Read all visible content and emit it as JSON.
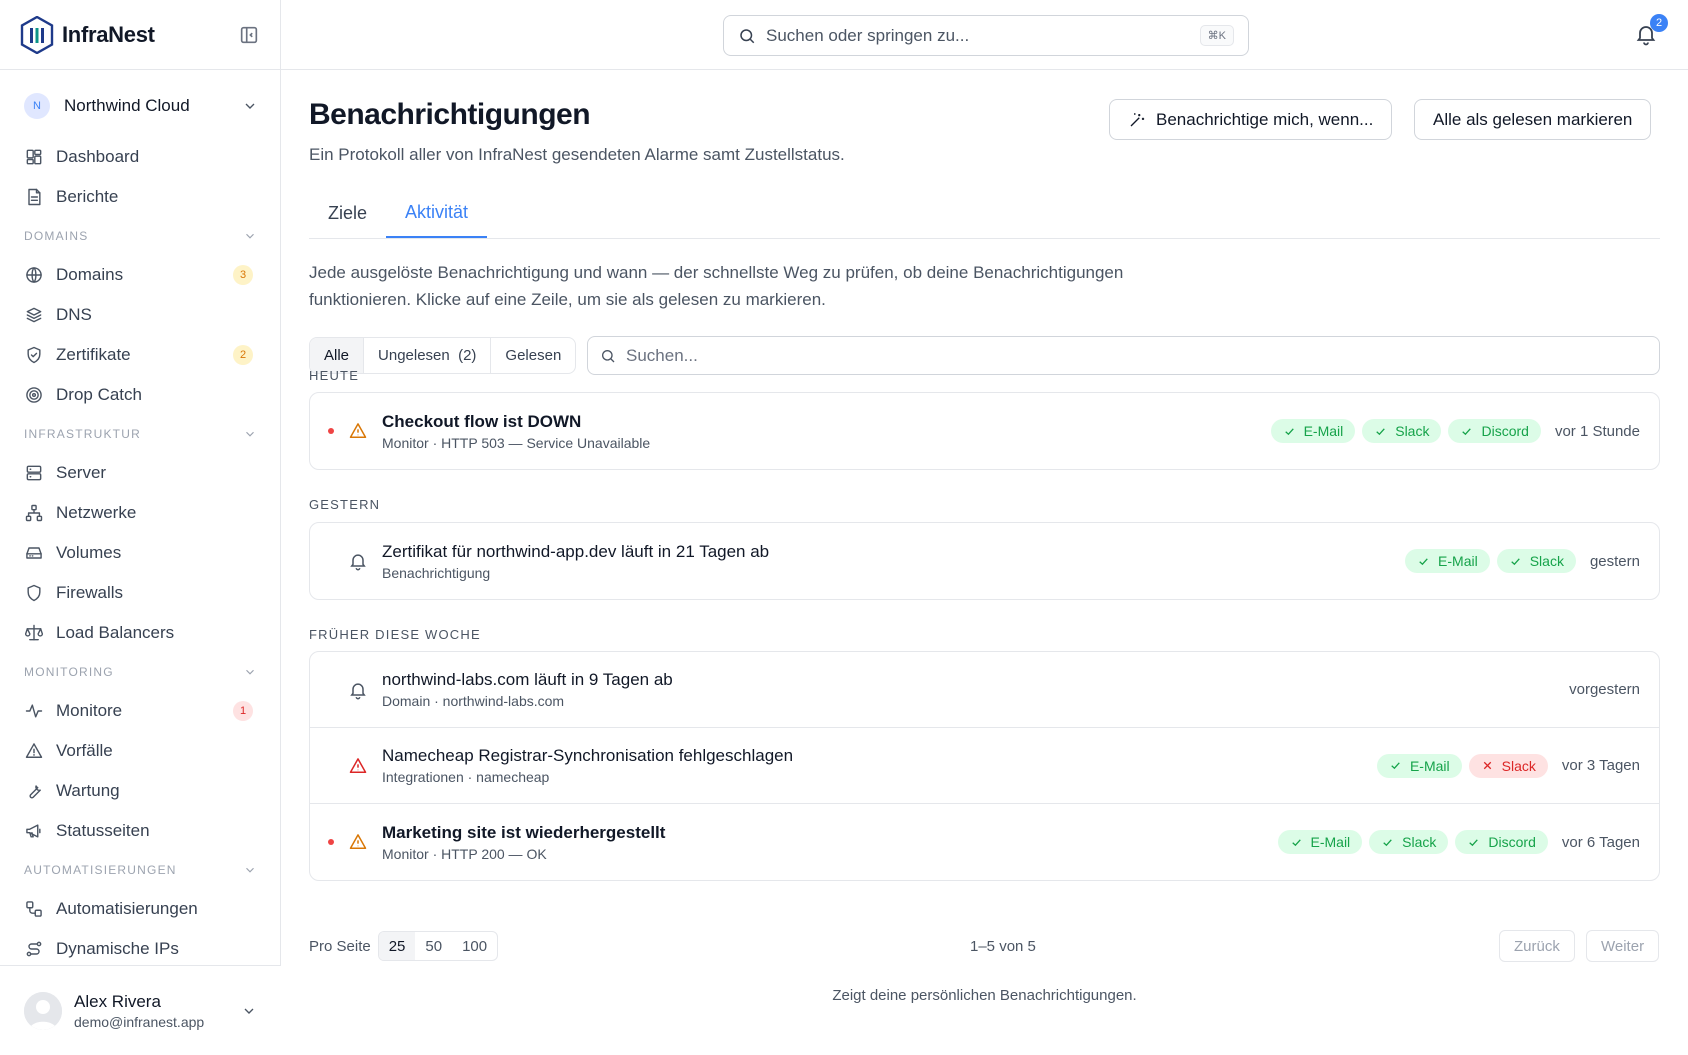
{
  "app": {
    "name": "InfraNest"
  },
  "workspace": {
    "initial": "N",
    "name": "Northwind Cloud"
  },
  "nav": {
    "top": [
      {
        "label": "Dashboard",
        "icon": "dashboard-icon"
      },
      {
        "label": "Berichte",
        "icon": "report-icon"
      }
    ],
    "sections": [
      {
        "title": "DOMAINS",
        "items": [
          {
            "label": "Domains",
            "icon": "globe-icon",
            "badge": "3",
            "badge_color": "amber"
          },
          {
            "label": "DNS",
            "icon": "layers-icon"
          },
          {
            "label": "Zertifikate",
            "icon": "shield-check-icon",
            "badge": "2",
            "badge_color": "amber"
          },
          {
            "label": "Drop Catch",
            "icon": "target-icon"
          }
        ]
      },
      {
        "title": "INFRASTRUKTUR",
        "items": [
          {
            "label": "Server",
            "icon": "server-icon"
          },
          {
            "label": "Netzwerke",
            "icon": "network-icon"
          },
          {
            "label": "Volumes",
            "icon": "hard-drive-icon"
          },
          {
            "label": "Firewalls",
            "icon": "shield-icon"
          },
          {
            "label": "Load Balancers",
            "icon": "scale-icon"
          }
        ]
      },
      {
        "title": "MONITORING",
        "items": [
          {
            "label": "Monitore",
            "icon": "activity-icon",
            "badge": "1",
            "badge_color": "red"
          },
          {
            "label": "Vorfälle",
            "icon": "alert-triangle-icon"
          },
          {
            "label": "Wartung",
            "icon": "wrench-icon"
          },
          {
            "label": "Statusseiten",
            "icon": "megaphone-icon"
          }
        ]
      },
      {
        "title": "AUTOMATISIERUNGEN",
        "items": [
          {
            "label": "Automatisierungen",
            "icon": "workflow-icon"
          },
          {
            "label": "Dynamische IPs",
            "icon": "route-icon"
          }
        ]
      }
    ]
  },
  "user": {
    "name": "Alex Rivera",
    "email": "demo@infranest.app"
  },
  "topbar": {
    "search_placeholder": "Suchen oder springen zu...",
    "shortcut": "⌘K",
    "notif_count": "2"
  },
  "page": {
    "title": "Benachrichtigungen",
    "subtitle": "Ein Protokoll aller von InfraNest gesendeten Alarme samt Zustellstatus.",
    "btn_notify": "Benachrichtige mich, wenn...",
    "btn_mark_all": "Alle als gelesen markieren",
    "tabs": [
      "Ziele",
      "Aktivität"
    ],
    "active_tab": 1,
    "intro": "Jede ausgelöste Benachrichtigung und wann — der schnellste Weg zu prüfen, ob deine Benachrichtigungen funktionieren. Klicke auf eine Zeile, um sie als gelesen zu markieren.",
    "filters": {
      "all": "Alle",
      "unread": "Ungelesen",
      "unread_count": "(2)",
      "read": "Gelesen"
    },
    "search_placeholder": "Suchen..."
  },
  "groups": [
    {
      "title": "HEUTE",
      "items": [
        {
          "unread": true,
          "icon": "warning-amber",
          "title": "Checkout flow ist DOWN",
          "meta": "Monitor · HTTP 503 — Service Unavailable",
          "channels": [
            {
              "name": "E-Mail",
              "status": "ok"
            },
            {
              "name": "Slack",
              "status": "ok"
            },
            {
              "name": "Discord",
              "status": "ok"
            }
          ],
          "time": "vor 1 Stunde"
        }
      ]
    },
    {
      "title": "GESTERN",
      "items": [
        {
          "unread": false,
          "icon": "bell",
          "title": "Zertifikat für northwind-app.dev läuft in 21 Tagen ab",
          "meta": "Benachrichtigung",
          "channels": [
            {
              "name": "E-Mail",
              "status": "ok"
            },
            {
              "name": "Slack",
              "status": "ok"
            }
          ],
          "time": "gestern"
        }
      ]
    },
    {
      "title": "FRÜHER DIESE WOCHE",
      "items": [
        {
          "unread": false,
          "icon": "bell",
          "title": "northwind-labs.com läuft in 9 Tagen ab",
          "meta": "Domain · northwind-labs.com",
          "channels": [],
          "time": "vorgestern"
        },
        {
          "unread": false,
          "icon": "warning-red",
          "title": "Namecheap Registrar-Synchronisation fehlgeschlagen",
          "meta": "Integrationen · namecheap",
          "channels": [
            {
              "name": "E-Mail",
              "status": "ok"
            },
            {
              "name": "Slack",
              "status": "fail"
            }
          ],
          "time": "vor 3 Tagen"
        },
        {
          "unread": true,
          "icon": "warning-amber",
          "title": "Marketing site ist wiederhergestellt",
          "meta": "Monitor · HTTP 200 — OK",
          "channels": [
            {
              "name": "E-Mail",
              "status": "ok"
            },
            {
              "name": "Slack",
              "status": "ok"
            },
            {
              "name": "Discord",
              "status": "ok"
            }
          ],
          "time": "vor 6 Tagen"
        }
      ]
    }
  ],
  "pager": {
    "label": "Pro Seite",
    "options": [
      "25",
      "50",
      "100"
    ],
    "active": "25",
    "range": "1–5 von 5",
    "prev": "Zurück",
    "next": "Weiter"
  },
  "footnote": "Zeigt deine persönlichen Benachrichtigungen.",
  "colors": {
    "accent": "#3b82f6",
    "ok": "#16a34a",
    "fail": "#dc2626",
    "warn": "#d97706"
  }
}
